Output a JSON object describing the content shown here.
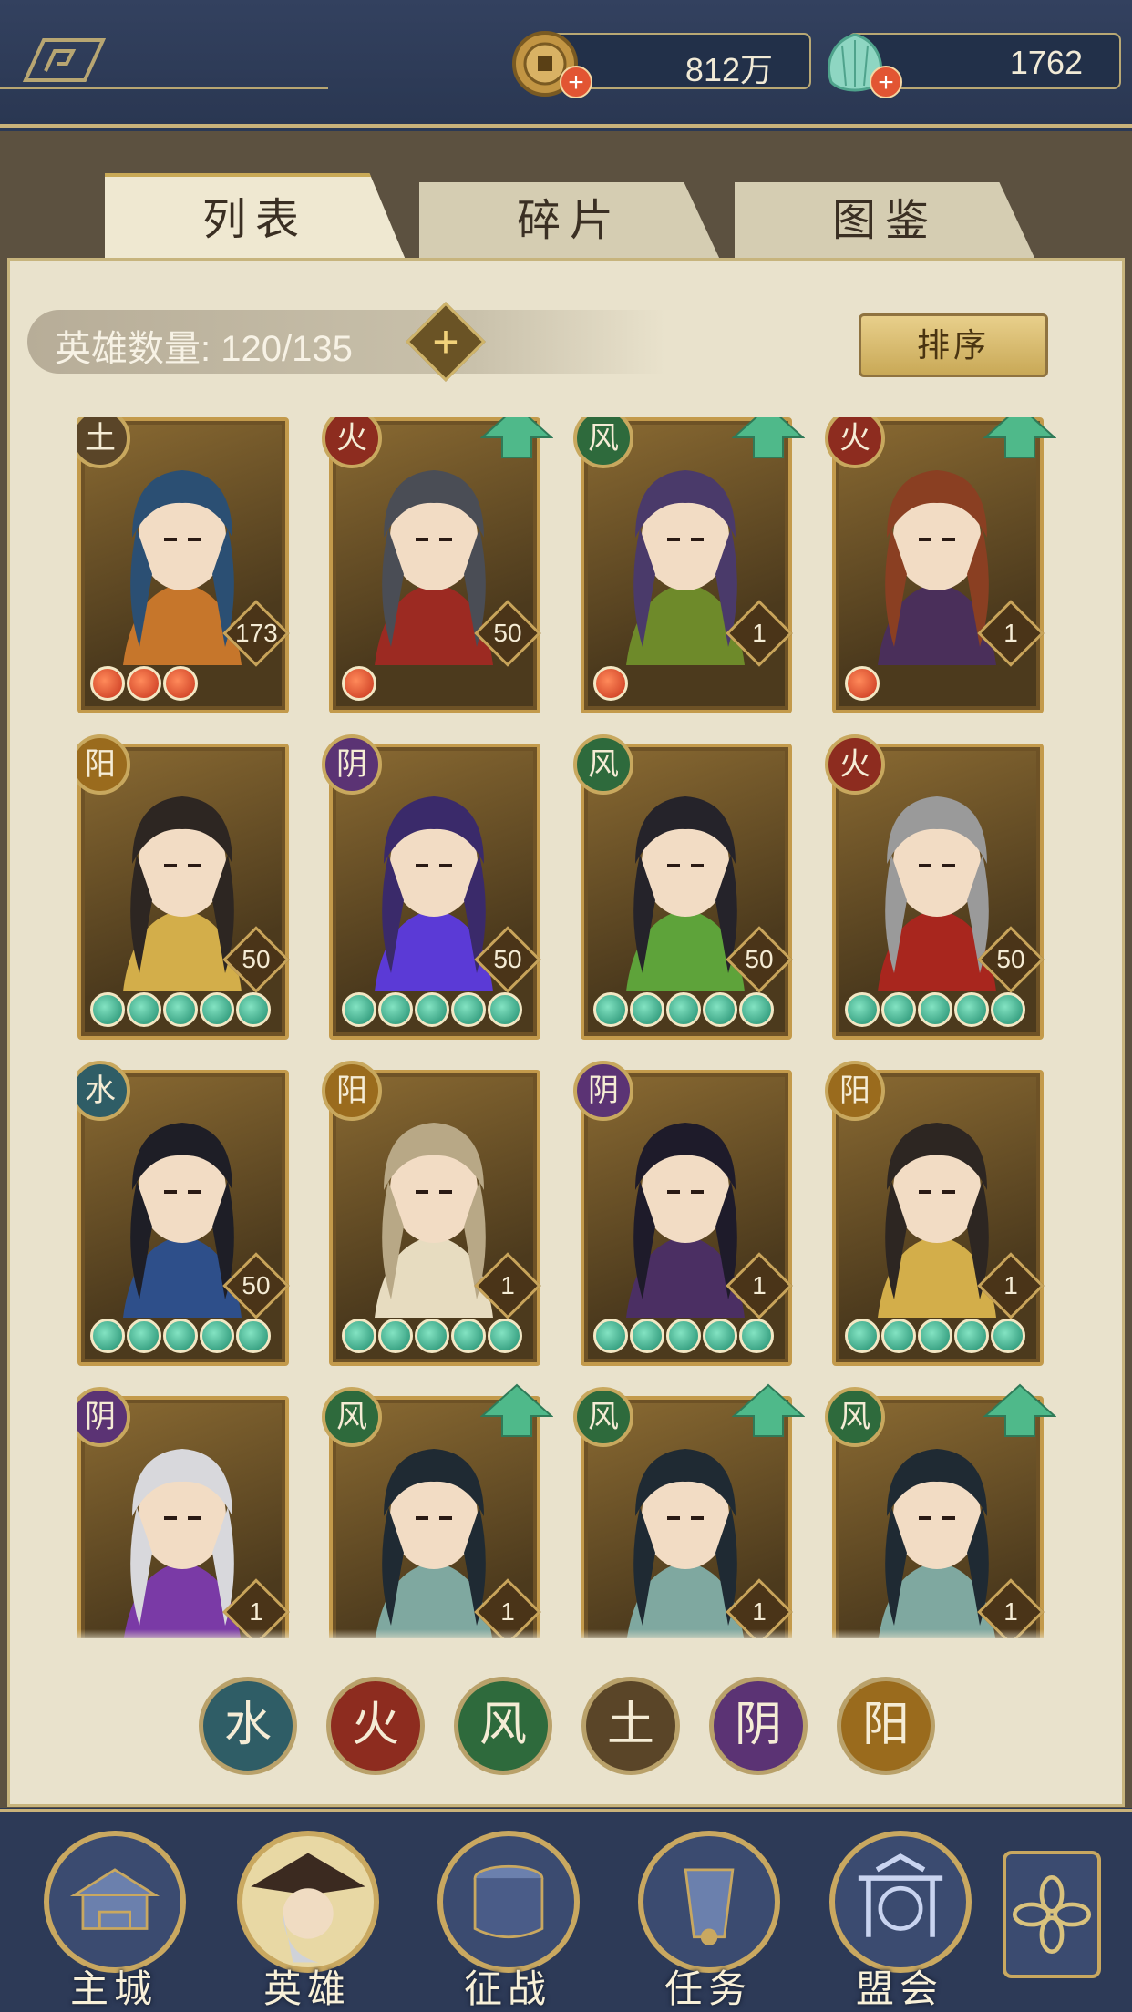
{
  "resources": {
    "coins": "812万",
    "gems": "1762"
  },
  "tabs": [
    {
      "label": "列表",
      "active": true
    },
    {
      "label": "碎片",
      "active": false
    },
    {
      "label": "图鉴",
      "active": false
    }
  ],
  "hero_count_label": "英雄数量: 120/135",
  "sort_label": "排序",
  "element_colors": {
    "水": "#2f5d66",
    "火": "#8d2c1f",
    "风": "#2e6a3c",
    "土": "#5a4528",
    "阴": "#5b3374",
    "阳": "#9a6b1d"
  },
  "heroes": [
    {
      "element": "土",
      "level": "173",
      "stars": 3,
      "star_color": "red",
      "upgrade": false,
      "hair": "#2b4f73",
      "robe": "#c6762b"
    },
    {
      "element": "火",
      "level": "50",
      "stars": 1,
      "star_color": "red",
      "upgrade": true,
      "hair": "#4a4d55",
      "robe": "#9c2a22"
    },
    {
      "element": "风",
      "level": "1",
      "stars": 1,
      "star_color": "red",
      "upgrade": true,
      "hair": "#4a3a6a",
      "robe": "#6e8a2a"
    },
    {
      "element": "火",
      "level": "1",
      "stars": 1,
      "star_color": "red",
      "upgrade": true,
      "hair": "#8a3f22",
      "robe": "#4a2f5a"
    },
    {
      "element": "阳",
      "level": "50",
      "stars": 5,
      "star_color": "jade",
      "upgrade": false,
      "hair": "#2d2622",
      "robe": "#d3ae4a"
    },
    {
      "element": "阴",
      "level": "50",
      "stars": 5,
      "star_color": "jade",
      "upgrade": false,
      "hair": "#3a2a6a",
      "robe": "#5b3ad6"
    },
    {
      "element": "风",
      "level": "50",
      "stars": 5,
      "star_color": "jade",
      "upgrade": false,
      "hair": "#25232a",
      "robe": "#5ea33a"
    },
    {
      "element": "火",
      "level": "50",
      "stars": 5,
      "star_color": "jade",
      "upgrade": false,
      "hair": "#9a9a9a",
      "robe": "#a8261e"
    },
    {
      "element": "水",
      "level": "50",
      "stars": 5,
      "star_color": "jade",
      "upgrade": false,
      "hair": "#1e1e26",
      "robe": "#2e4f8a"
    },
    {
      "element": "阳",
      "level": "1",
      "stars": 5,
      "star_color": "jade",
      "upgrade": false,
      "hair": "#b8a886",
      "robe": "#e7dcc0"
    },
    {
      "element": "阴",
      "level": "1",
      "stars": 5,
      "star_color": "jade",
      "upgrade": false,
      "hair": "#1e1b2a",
      "robe": "#4b2f63"
    },
    {
      "element": "阳",
      "level": "1",
      "stars": 5,
      "star_color": "jade",
      "upgrade": false,
      "hair": "#2d2622",
      "robe": "#d3ae4a"
    },
    {
      "element": "阴",
      "level": "1",
      "stars": 0,
      "star_color": "jade",
      "upgrade": false,
      "hair": "#d8d8dc",
      "robe": "#7a3aa6"
    },
    {
      "element": "风",
      "level": "1",
      "stars": 0,
      "star_color": "jade",
      "upgrade": true,
      "hair": "#1f2a33",
      "robe": "#7fa8a0"
    },
    {
      "element": "风",
      "level": "1",
      "stars": 0,
      "star_color": "jade",
      "upgrade": true,
      "hair": "#1f2a33",
      "robe": "#7fa8a0"
    },
    {
      "element": "风",
      "level": "1",
      "stars": 0,
      "star_color": "jade",
      "upgrade": true,
      "hair": "#1f2a33",
      "robe": "#7fa8a0"
    }
  ],
  "element_filters": [
    "水",
    "火",
    "风",
    "土",
    "阴",
    "阳"
  ],
  "nav": [
    {
      "label": "主城",
      "active": false
    },
    {
      "label": "英雄",
      "active": true
    },
    {
      "label": "征战",
      "active": false
    },
    {
      "label": "任务",
      "active": false
    },
    {
      "label": "盟会",
      "active": false
    }
  ]
}
